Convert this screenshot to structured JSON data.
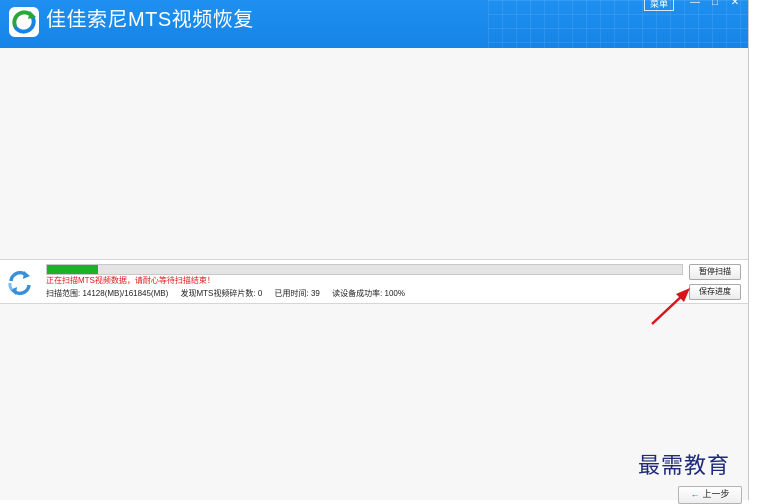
{
  "app": {
    "title": "佳佳索尼MTS视频恢复",
    "menu_label": "菜单",
    "window_controls": {
      "minimize": "—",
      "maximize": "□",
      "close": "✕"
    }
  },
  "scan": {
    "progress_fraction": 0.08,
    "status_message": "正在扫描MTS视频数据，请耐心等待扫描结束！",
    "scan_range": "扫描范围: 14128(MB)/161845(MB)",
    "fragments_found": "发现MTS视频碎片数: 0",
    "elapsed_time": "已用时间: 39",
    "read_success_rate": "读设备成功率: 100%"
  },
  "buttons": {
    "pause_scan": "暂停扫描",
    "save_progress": "保存进度",
    "back": "上一步"
  },
  "watermark": "最需教育",
  "icons": {
    "logo": "app-logo-icon",
    "scan": "refresh-cycle-icon",
    "arrow": "red-pointer-arrow-icon",
    "back": "arrow-left-icon"
  },
  "colors": {
    "titlebar": "#1684e6",
    "progress": "#1fb02a",
    "status_text": "#e0161a",
    "annotation_arrow": "#d9141b",
    "watermark": "#1f2a7a"
  }
}
